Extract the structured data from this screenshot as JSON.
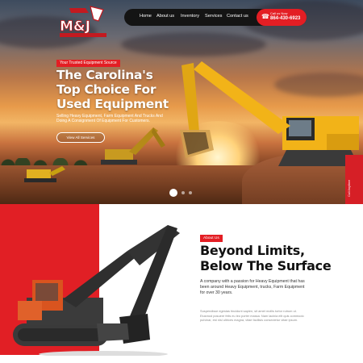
{
  "header": {
    "logo_text": "M&J",
    "nav": [
      "Home",
      "About us",
      "Inventory",
      "Services",
      "Contact us"
    ],
    "phone_label": "Call us Now",
    "phone_number": "864-430-6923"
  },
  "hero": {
    "tag": "Your Trusted Equipment Source",
    "title": "The Carolina's Top Choice For Used Equipment",
    "description": "Selling Heavy Equipment, Farm Equipment And Trucks And Doing A Consignment Of Equipment For Customers.",
    "cta": "View All Services",
    "side_badge": "Call Anytime",
    "slider_dots": 3,
    "active_dot": 1
  },
  "about": {
    "tag": "About Us",
    "title": "Beyond Limits, Below The Surface",
    "lead": "A company with a passion for Heavy Equipment that has been around Heavy Equipment, trucks, Farm Equipment for over 30 years.",
    "body": "Suspendisse egestas tincidunt sapien, sit amet mollis tortor rutrum ut. Eiusmod posuere felis eu leo porter massa. Nam lacinia elit quis commodo pulvinar, est nisl ultrices magna, vitae facilisis consectetur vitae ipsum."
  },
  "colors": {
    "brand_red": "#e31e24",
    "nav_dark": "#141414",
    "excavator_yellow": "#f2b318",
    "excavator_orange": "#e0612a"
  },
  "icons": [
    "phone-icon"
  ]
}
